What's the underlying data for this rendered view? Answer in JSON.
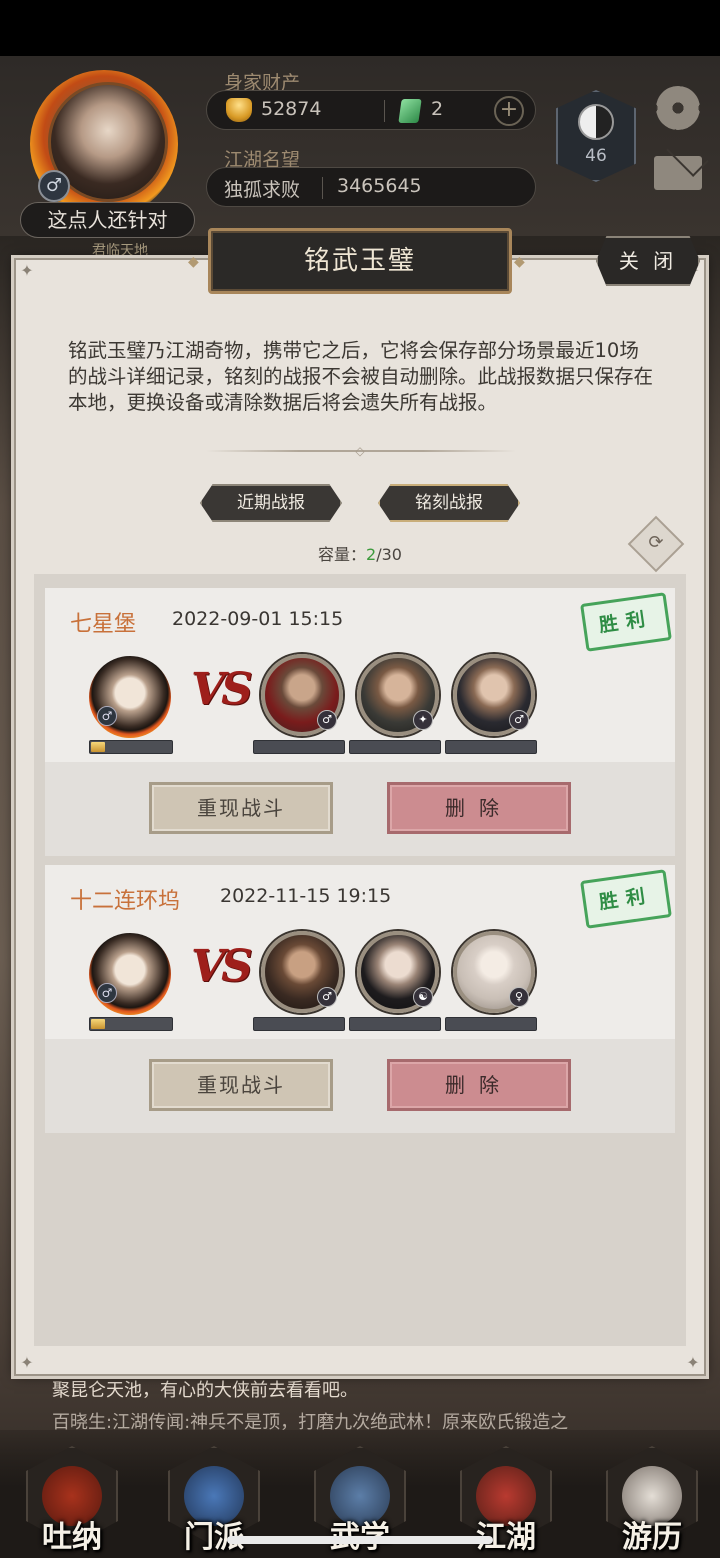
{
  "player": {
    "name": "这点人还针对",
    "gender_symbol": "♂",
    "sub_title": "君临天地",
    "wealth_label": "身家财产",
    "gold": "52874",
    "jade": "2",
    "plus": "+",
    "fame_label": "江湖名望",
    "fame_title": "独孤求败",
    "fame_value": "3465645",
    "sect_level": "46"
  },
  "modal": {
    "title": "铭武玉璧",
    "close_label": "关 闭",
    "description": "铭武玉璧乃江湖奇物，携带它之后，它将会保存部分场景最近10场的战斗详细记录，铭刻的战报不会被自动删除。此战报数据只保存在本地，更换设备或清除数据后将会遗失所有战报。",
    "tabs": [
      {
        "label": "近期战报",
        "active": false
      },
      {
        "label": "铭刻战报",
        "active": true
      }
    ],
    "capacity_label": "容量：",
    "capacity_current": "2",
    "capacity_total": "/30"
  },
  "records": [
    {
      "location": "七星堡",
      "time": "2022-09-01 15:15",
      "result": "胜利",
      "hero_progress": 0.18,
      "vs": "VS",
      "enemy_badges": [
        "♂",
        "✦",
        "♂"
      ],
      "replay_label": "重现战斗",
      "delete_label": "删除"
    },
    {
      "location": "十二连环坞",
      "time": "2022-11-15 19:15",
      "result": "胜利",
      "hero_progress": 0.18,
      "vs": "VS",
      "enemy_badges": [
        "♂",
        "☯",
        "♀"
      ],
      "replay_label": "重现战斗",
      "delete_label": "删除"
    }
  ],
  "background_chat": {
    "line1": "聚昆仑天池，有心的大侠前去看看吧。",
    "line2": "百晓生:江湖传闻:神兵不是顶，打磨九次绝武林！原来欧氏锻造之"
  },
  "bottom_nav": [
    {
      "label": "吐纳",
      "icon": "meditation-icon"
    },
    {
      "label": "门派",
      "icon": "sect-icon"
    },
    {
      "label": "武学",
      "icon": "martial-book-icon"
    },
    {
      "label": "江湖",
      "icon": "bamboo-hat-icon"
    },
    {
      "label": "游历",
      "icon": "horse-icon"
    }
  ],
  "colors": {
    "location": "#c8713a",
    "victory": "#2f8d45",
    "vs": "#9e1f1b",
    "capacity_current": "#3c9a3c",
    "delete_button": "#cc8c90",
    "replay_button": "#cfc5b4"
  }
}
